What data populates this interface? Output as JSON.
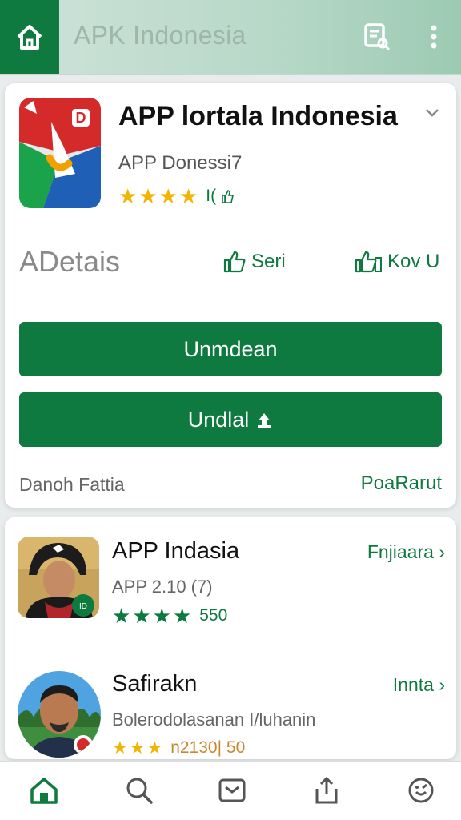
{
  "header": {
    "title": "APK Indonesia",
    "icons": [
      "home-icon",
      "search-doc-icon",
      "more-vert-icon"
    ]
  },
  "main_card": {
    "app_title": "APP lortala Indonesia",
    "subtitle": "APP Donessi7",
    "rating_stars": 4,
    "review_count": "I(",
    "details_label": "ADetais",
    "like_1": "Seri",
    "like_2": "Kov U",
    "primary_button": "Unmdean",
    "secondary_button": "Undlal",
    "footer_left": "Danoh Fattia",
    "footer_right": "PoaRarut"
  },
  "list": [
    {
      "name": "APP Indasia",
      "meta": "APP 2.10 (7)",
      "stars": 4,
      "count": "550",
      "action": "Fnjiaara"
    },
    {
      "name": "Safirakn",
      "meta": "Bolerodolasanan I/luhanin",
      "stars": 3,
      "count": "n2130| 50",
      "action": "Innta"
    }
  ],
  "bottom_nav": [
    "home-icon",
    "search-icon",
    "mail-icon",
    "share-icon",
    "settings-icon"
  ],
  "colors": {
    "accent": "#0f7a3f",
    "star": "#f2b400",
    "header_bg": "#b7d8c8"
  }
}
